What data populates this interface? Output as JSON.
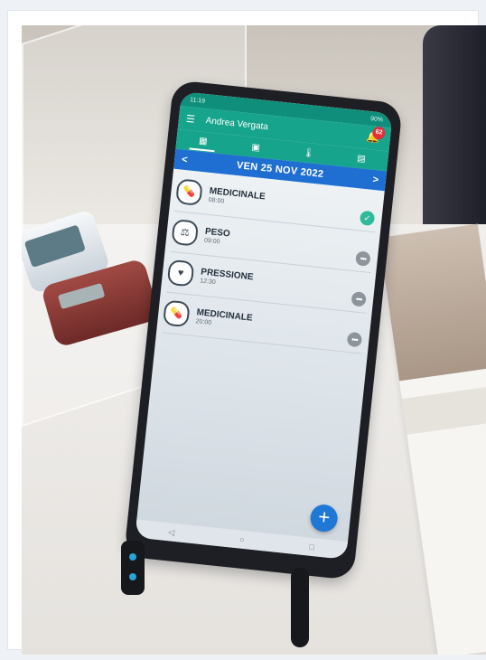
{
  "statusbar": {
    "time": "11:19",
    "battery": "90%"
  },
  "app": {
    "user_name": "Andrea Vergata",
    "notification_count": "62"
  },
  "tabs": [
    {
      "name": "calendar-icon",
      "symbol": "▦"
    },
    {
      "name": "chat-icon",
      "symbol": "▣"
    },
    {
      "name": "thermometer-icon",
      "symbol": "🌡"
    },
    {
      "name": "clipboard-icon",
      "symbol": "▤"
    }
  ],
  "date": {
    "label": "VEN 25 NOV 2022",
    "prev": "<",
    "next": ">"
  },
  "items": [
    {
      "title": "MEDICINALE",
      "time": "08:00",
      "icon": "pill-icon",
      "symbol": "💊",
      "status": "done"
    },
    {
      "title": "PESO",
      "time": "09:00",
      "icon": "scale-icon",
      "symbol": "⚖",
      "status": "more"
    },
    {
      "title": "PRESSIONE",
      "time": "12:30",
      "icon": "blood-pressure-icon",
      "symbol": "♥",
      "status": "more"
    },
    {
      "title": "MEDICINALE",
      "time": "20:00",
      "icon": "pill-icon",
      "symbol": "💊",
      "status": "more"
    }
  ],
  "fab": {
    "label": "+"
  },
  "colors": {
    "appbar": "#17a48c",
    "datebar": "#1f6fd2",
    "done": "#2fbb9a",
    "fab": "#1f78d6"
  }
}
